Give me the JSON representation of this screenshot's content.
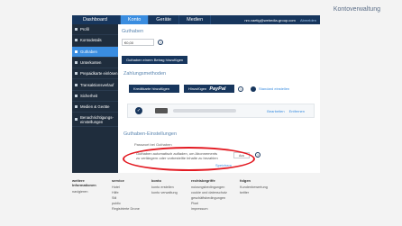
{
  "page_title": "Kontoverwaltung",
  "topnav": {
    "tabs": [
      "Dashboard",
      "Konto",
      "Geräte",
      "Medien"
    ],
    "active": "Konto",
    "user_email": "nrx.vaetig@webedia-group.com",
    "logout": "Abmelden"
  },
  "sidebar": {
    "items": [
      {
        "label": "Profil",
        "active": false
      },
      {
        "label": "Kontodetails",
        "active": false
      },
      {
        "label": "Guthaben",
        "active": true
      },
      {
        "label": "Unterkonten",
        "active": false
      },
      {
        "label": "Prepaidkarte einlösen",
        "active": false
      },
      {
        "label": "Transaktionsverlauf",
        "active": false
      },
      {
        "label": "Sicherheit",
        "active": false
      },
      {
        "label": "Medien & Geräte",
        "active": false
      },
      {
        "label": "Benachrichtigungs-einstellungen",
        "active": false
      }
    ]
  },
  "guthaben": {
    "title": "Guthaben",
    "amount": "€0,00",
    "add_button": "Guthaben einem Betrag hinzufügen",
    "help": "?"
  },
  "zahlungsmethoden": {
    "title": "Zahlungsmethoden",
    "add_card": "Kreditkarte hinzufügen",
    "add_paypal_prefix": "Hinzufügen",
    "paypal": "PayPal",
    "standard_link": "Standard einstellen",
    "edit": "Bearbeiten",
    "remove": "Entfernen"
  },
  "guthaben_einstellungen": {
    "title": "Guthaben-Einstellungen",
    "option": "Passwort bei Guthaben",
    "description_line1": "Guthaben automatisch aufladen, um Abonnements",
    "description_line2": "zu verlängern oder vorbestellte Inhalte zu bezahlen",
    "toggle": "Aus",
    "help": "?",
    "save": "Speichern"
  },
  "footer": {
    "columns": [
      {
        "title": "weitere Informationen",
        "items": [
          "navigieren"
        ]
      },
      {
        "title": "service",
        "items": [
          "Hotel",
          "Hilfe",
          "Stil",
          "public",
          "Registrierte Drone"
        ]
      },
      {
        "title": "konto",
        "items": [
          "konto erstellen",
          "konto verwaltung"
        ]
      },
      {
        "title": "rechtsbegriffe",
        "items": [
          "nutzungsbedingungen",
          "cookie und datenschutz",
          "geschäftsbedingungen",
          "Pixel",
          "impressum"
        ]
      },
      {
        "title": "folgen",
        "items": [
          "Kundenbewertung",
          "twitter"
        ]
      }
    ]
  },
  "colors": {
    "nav": "#17365d",
    "accent": "#3a8de0",
    "sidebar": "#1f2d3d",
    "highlight": "#e31b23"
  }
}
